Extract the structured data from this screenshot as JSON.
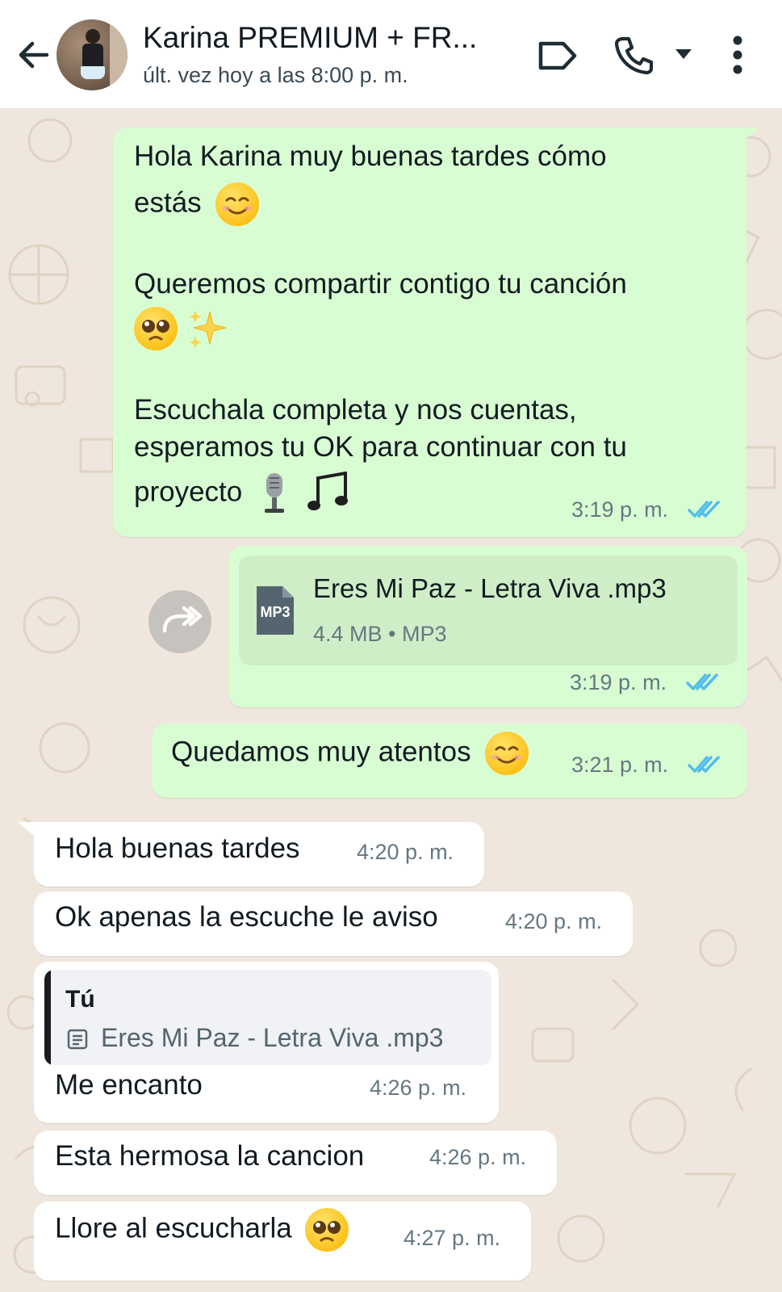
{
  "header": {
    "contact_name": "Karina PREMIUM + FR...",
    "last_seen": "últ. vez hoy a las 8:00 p. m.",
    "icons": [
      "back-arrow-icon",
      "avatar",
      "label-icon",
      "phone-icon",
      "caret-down-icon",
      "more-vert-icon"
    ]
  },
  "messages": {
    "m1": {
      "line1": "Hola Karina muy buenas tardes cómo",
      "line2": "estás",
      "line3": "Queremos compartir contigo tu canción",
      "line4": "Escuchala completa y nos cuentas,",
      "line5": "esperamos tu OK para continuar con tu",
      "line6": "proyecto",
      "time": "3:19 p. m."
    },
    "m2": {
      "file_name": "Eres Mi Paz  - Letra Viva .mp3",
      "file_meta": "4.4 MB • MP3",
      "file_badge": "MP3",
      "time": "3:19 p. m."
    },
    "m3": {
      "text": "Quedamos muy atentos",
      "time": "3:21 p. m."
    },
    "m4": {
      "text": "Hola buenas tardes",
      "time": "4:20 p. m."
    },
    "m5": {
      "text": "Ok apenas la escuche le aviso",
      "time": "4:20 p. m."
    },
    "m6": {
      "quote_author": "Tú",
      "quote_file": "Eres Mi Paz  - Letra Viva .mp3",
      "text": "Me encanto",
      "time": "4:26 p. m."
    },
    "m7": {
      "text": "Esta hermosa la cancion",
      "time": "4:26 p. m."
    },
    "m8": {
      "text": "Llore al escucharla",
      "time": "4:27 p. m."
    }
  },
  "colors": {
    "outgoing_bubble": "#d9fdd3",
    "incoming_bubble": "#ffffff",
    "chat_background": "#efe7dd",
    "read_ticks": "#53bdeb"
  }
}
